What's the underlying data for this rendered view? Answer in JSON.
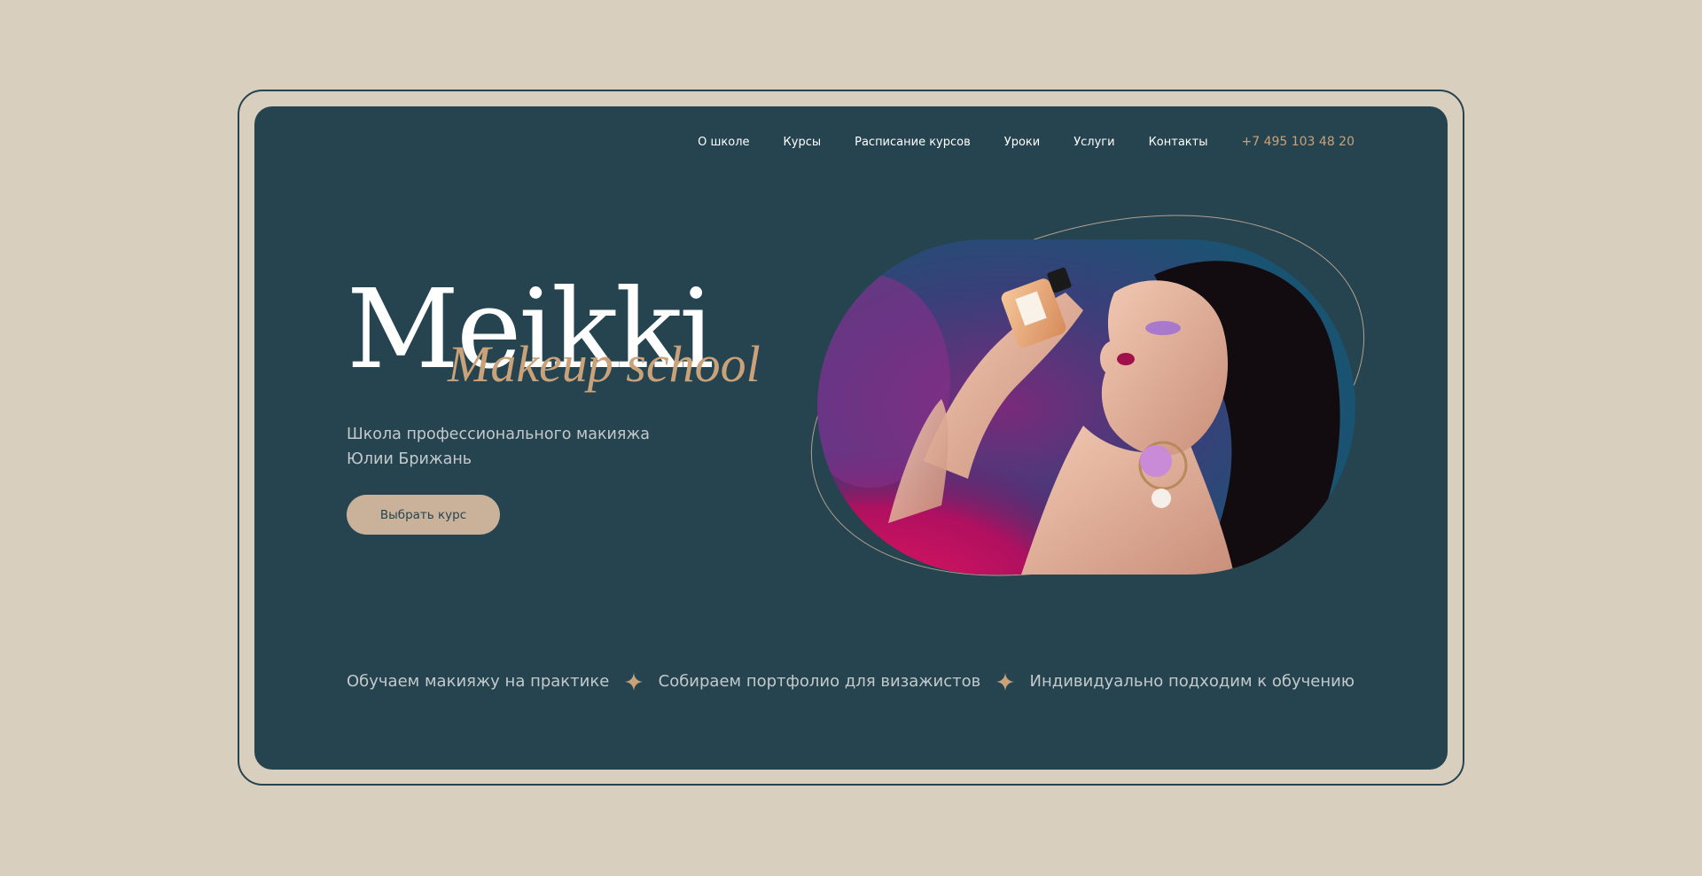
{
  "nav": {
    "items": [
      {
        "label": "О школе"
      },
      {
        "label": "Курсы"
      },
      {
        "label": "Расписание курсов"
      },
      {
        "label": "Уроки"
      },
      {
        "label": "Услуги"
      },
      {
        "label": "Контакты"
      }
    ],
    "phone": "+7 495 103 48 20"
  },
  "hero": {
    "brand": "Meikki",
    "brand_script": "Makeup school",
    "tagline_line1": "Школа профессионального макияжа",
    "tagline_line2": "Юлии Брижань",
    "cta_label": "Выбрать курс",
    "image_subject": "woman-with-perfume-bottle-photo"
  },
  "features": [
    {
      "label": "Обучаем макияжу на практике"
    },
    {
      "label": "Собираем портфолио для визажистов"
    },
    {
      "label": "Индивидуально подходим к обучению"
    }
  ],
  "colors": {
    "page_bg": "#d9cfbe",
    "panel_bg": "#26444f",
    "accent_gold": "#c9a27a",
    "button_bg": "#c9b299",
    "text_muted": "#c3c9cb"
  }
}
